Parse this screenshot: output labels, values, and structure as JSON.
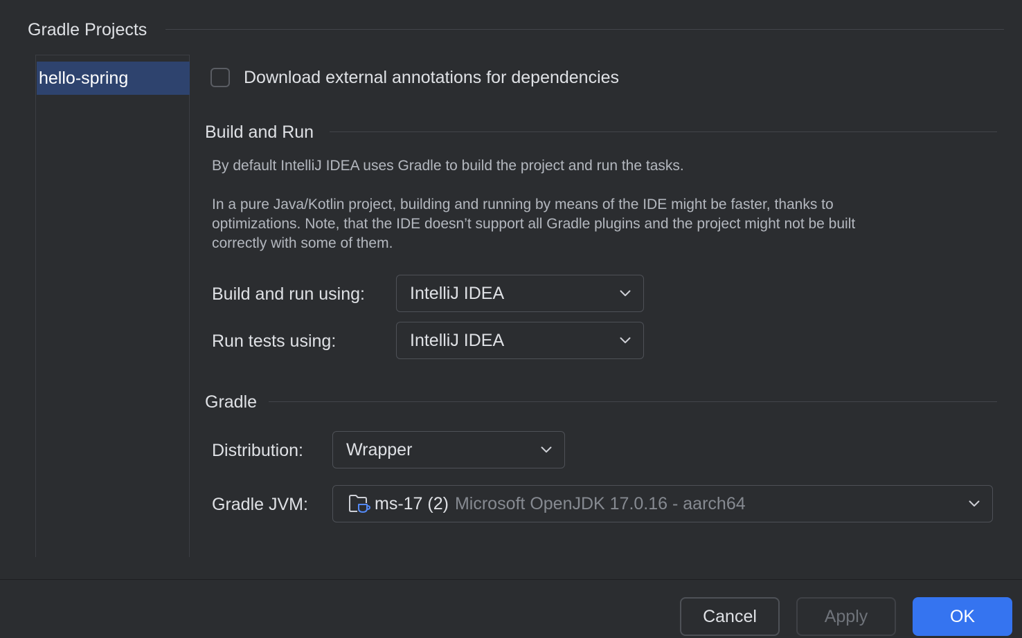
{
  "section": {
    "title": "Gradle Projects"
  },
  "projects": {
    "items": [
      {
        "label": "hello-spring",
        "selected": true
      }
    ]
  },
  "download_annotations": {
    "label": "Download external annotations for dependencies",
    "checked": false
  },
  "build_and_run": {
    "title": "Build and Run",
    "desc1": "By default IntelliJ IDEA uses Gradle to build the project and run the tasks.",
    "desc2_line1": "In a pure Java/Kotlin project, building and running by means of the IDE might be faster, thanks to",
    "desc2_line2": "optimizations. Note, that the IDE doesn’t support all Gradle plugins and the project might not be built",
    "desc2_line3": "correctly with some of them.",
    "build_label": "Build and run using:",
    "build_value": "IntelliJ IDEA",
    "tests_label": "Run tests using:",
    "tests_value": "IntelliJ IDEA"
  },
  "gradle": {
    "title": "Gradle",
    "distribution_label": "Distribution:",
    "distribution_value": "Wrapper",
    "jvm_label": "Gradle JVM:",
    "jvm_name": "ms-17 (2)",
    "jvm_desc": "Microsoft OpenJDK 17.0.16 - aarch64",
    "jvm_icon": "jdk-folder-icon"
  },
  "footer": {
    "cancel_label": "Cancel",
    "apply_label": "Apply",
    "apply_enabled": false,
    "ok_label": "OK"
  },
  "colors": {
    "background": "#2b2d30",
    "selection": "#2e436e",
    "accent": "#3574f0",
    "jdk_icon_blue": "#548af7"
  }
}
